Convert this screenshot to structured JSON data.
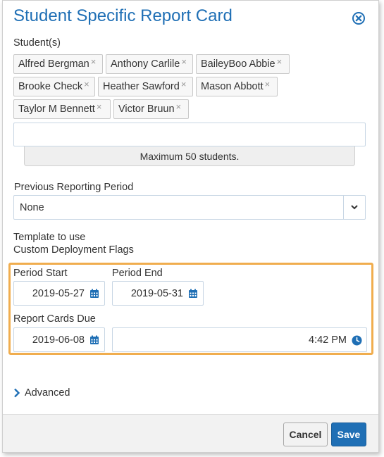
{
  "dialog": {
    "title": "Student Specific Report Card",
    "close_icon": "close-circle-icon"
  },
  "students": {
    "label": "Student(s)",
    "chips": [
      "Alfred Bergman",
      "Anthony Carlile",
      "BaileyBoo Abbie",
      "Brooke Check",
      "Heather Sawford",
      "Mason Abbott",
      "Taylor M Bennett",
      "Victor Bruun"
    ],
    "remove_glyph": "×",
    "search_value": "",
    "hint": "Maximum 50 students."
  },
  "previous_period": {
    "label": "Previous Reporting Period",
    "selected": "None"
  },
  "template": {
    "label": "Template to use",
    "value": "Custom Deployment Flags"
  },
  "dates": {
    "period_start_label": "Period Start",
    "period_start": "2019-05-27",
    "period_end_label": "Period End",
    "period_end": "2019-05-31",
    "due_label": "Report Cards Due",
    "due_date": "2019-06-08",
    "due_time": "4:42 PM"
  },
  "advanced": {
    "label": "Advanced"
  },
  "footer": {
    "cancel_label": "Cancel",
    "save_label": "Save"
  },
  "colors": {
    "accent": "#1f6fb5",
    "highlight": "#f0ad4e"
  }
}
